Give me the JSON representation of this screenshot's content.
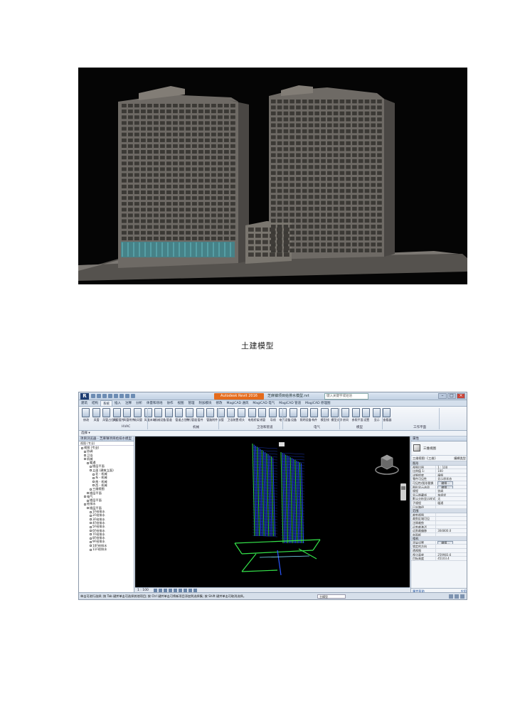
{
  "caption": "土建模型",
  "revit": {
    "app_badge": "R",
    "window_title": "Autodesk Revit 2016",
    "document_title": "芝麻镇项目给排水模型.rvt",
    "search_placeholder": "键入关键字或短语",
    "tabs": [
      "建筑",
      "结构",
      "系统",
      "插入",
      "注释",
      "分析",
      "体量和场地",
      "协作",
      "视图",
      "管理",
      "附加模块",
      "修改",
      "MagiCAD 通风",
      "MagiCAD 电气",
      "MagiCAD 管道",
      "MagiCAD 原理图"
    ],
    "tools": [
      "修改",
      "风管",
      "风管占位符",
      "风管管件",
      "风管附件",
      "软风管",
      "风道末端",
      "机械设备",
      "管道",
      "管道占位符",
      "平行管道",
      "管件",
      "管路附件",
      "软管",
      "卫浴装置",
      "喷头",
      "电缆桥架",
      "线管",
      "导线",
      "电气设备",
      "设备",
      "照明设备",
      "构件",
      "模型线",
      "模型文字",
      "房间",
      "参照平面",
      "设置",
      "显示",
      "查看器"
    ],
    "groups": [
      "HVAC",
      "机械",
      "卫浴和管道",
      "电气",
      "模型",
      "工作平面"
    ],
    "select_label": "选择 ▾",
    "browser": {
      "title": "项目浏览器 - 芝麻镇项目给排水模型",
      "filter": "视图 (专业)",
      "items": [
        "视图 (专业)",
        "协调",
        "卫浴",
        "机械",
        "暖通",
        "楼层平面",
        "立面 (建筑立面)",
        "北 - 机械",
        "东 - 机械",
        "南 - 机械",
        "西 - 机械",
        "三维视图",
        "楼层平面",
        "电气",
        "楼层平面",
        "给排水",
        "楼层平面",
        "1F给排水",
        "2F给排水",
        "3F给排水",
        "4F给排水",
        "5F给排水",
        "6F给排水",
        "7F给排水",
        "8F给排水",
        "9F给排水",
        "10F给排水",
        "11F给排水"
      ]
    },
    "view_scale": "1 : 100",
    "properties": {
      "title": "属性",
      "type_name": "三维视图",
      "selector": "三维视图: {三维}",
      "edit_type": "编辑类型",
      "sections": [
        {
          "name": "图形",
          "rows": [
            [
              "视图比例",
              "1 : 100"
            ],
            [
              "比例值 1:",
              "100"
            ],
            [
              "详细程度",
              "精细"
            ],
            [
              "零件可见性",
              "显示原状态"
            ],
            [
              "可见性/图形替换",
              "编辑..."
            ],
            [
              "图形显示选项",
              "编辑..."
            ],
            [
              "规程",
              "协调"
            ],
            [
              "显示隐藏线",
              "按规程"
            ],
            [
              "默认分析显示样式",
              "无"
            ],
            [
              "子规程",
              "暖通"
            ],
            [
              "日光路径",
              ""
            ]
          ]
        },
        {
          "name": "范围",
          "rows": [
            [
              "裁剪视图",
              ""
            ],
            [
              "裁剪区域可见",
              ""
            ],
            [
              "注释裁剪",
              ""
            ],
            [
              "远剪裁激活",
              ""
            ],
            [
              "远剪裁偏移",
              "304800.0"
            ],
            [
              "剖面框",
              ""
            ]
          ]
        },
        {
          "name": "相机",
          "rows": [
            [
              "渲染设置",
              "编辑..."
            ],
            [
              "锁定的方向",
              ""
            ],
            [
              "透视图",
              ""
            ],
            [
              "视点高度",
              "259983.6"
            ],
            [
              "目标高度",
              "45103.4"
            ]
          ]
        }
      ],
      "help_link": "属性帮助",
      "apply": "应用"
    },
    "status_message": "单击可进行选择; 按 Tab 键并单击可选择其他项目; 按 Ctrl 键并单击可将新项目添加到选择集; 按 Shift 键并单击可取消选择。",
    "active_model": "主模型"
  }
}
